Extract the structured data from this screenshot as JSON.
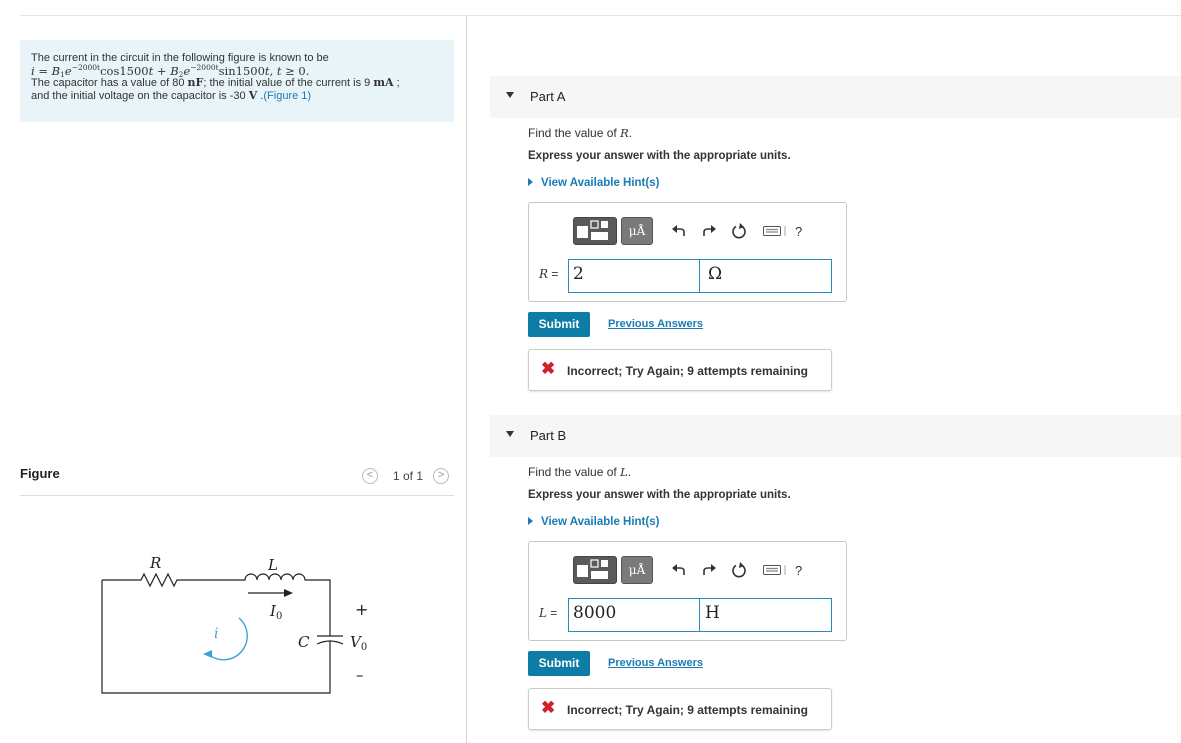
{
  "problem": {
    "line1": "The current in the circuit in the following figure is known to be",
    "line3_a": "The capacitor has a value of 80 ",
    "line3_unit1": "nF",
    "line3_b": "; the initial value of the current is 9 ",
    "line3_unit2": "mA",
    "line3_c": " ;",
    "line4_a": "and the initial voltage on the capacitor is -30 ",
    "line4_unit": "V",
    "line4_b": " .",
    "figure_link": "(Figure 1)"
  },
  "figure": {
    "label": "Figure",
    "pager": "1 of 1",
    "prev_glyph": "<",
    "next_glyph": ">"
  },
  "circuit": {
    "R": "R",
    "L": "L",
    "I0": "I",
    "I0_sub": "0",
    "i": "i",
    "C": "C",
    "V0": "V",
    "V0_sub": "0",
    "plus": "+",
    "minus": "–"
  },
  "toolbar": {
    "units_label": "μÅ",
    "help": "?"
  },
  "parts": [
    {
      "header": "Part A",
      "question_pre": "Find the value of ",
      "question_var": "R",
      "question_post": ".",
      "instructions": "Express your answer with the appropriate units.",
      "hint": "View Available Hint(s)",
      "field_var": "R",
      "field_eq": " =",
      "value": "2",
      "unit": "Ω",
      "submit": "Submit",
      "previous": "Previous Answers",
      "feedback": "Incorrect; Try Again; 9 attempts remaining"
    },
    {
      "header": "Part B",
      "question_pre": "Find the value of ",
      "question_var": "L",
      "question_post": ".",
      "instructions": "Express your answer with the appropriate units.",
      "hint": "View Available Hint(s)",
      "field_var": "L",
      "field_eq": " =",
      "value": "8000",
      "unit": "H",
      "submit": "Submit",
      "previous": "Previous Answers",
      "feedback": "Incorrect; Try Again; 9 attempts remaining"
    }
  ]
}
